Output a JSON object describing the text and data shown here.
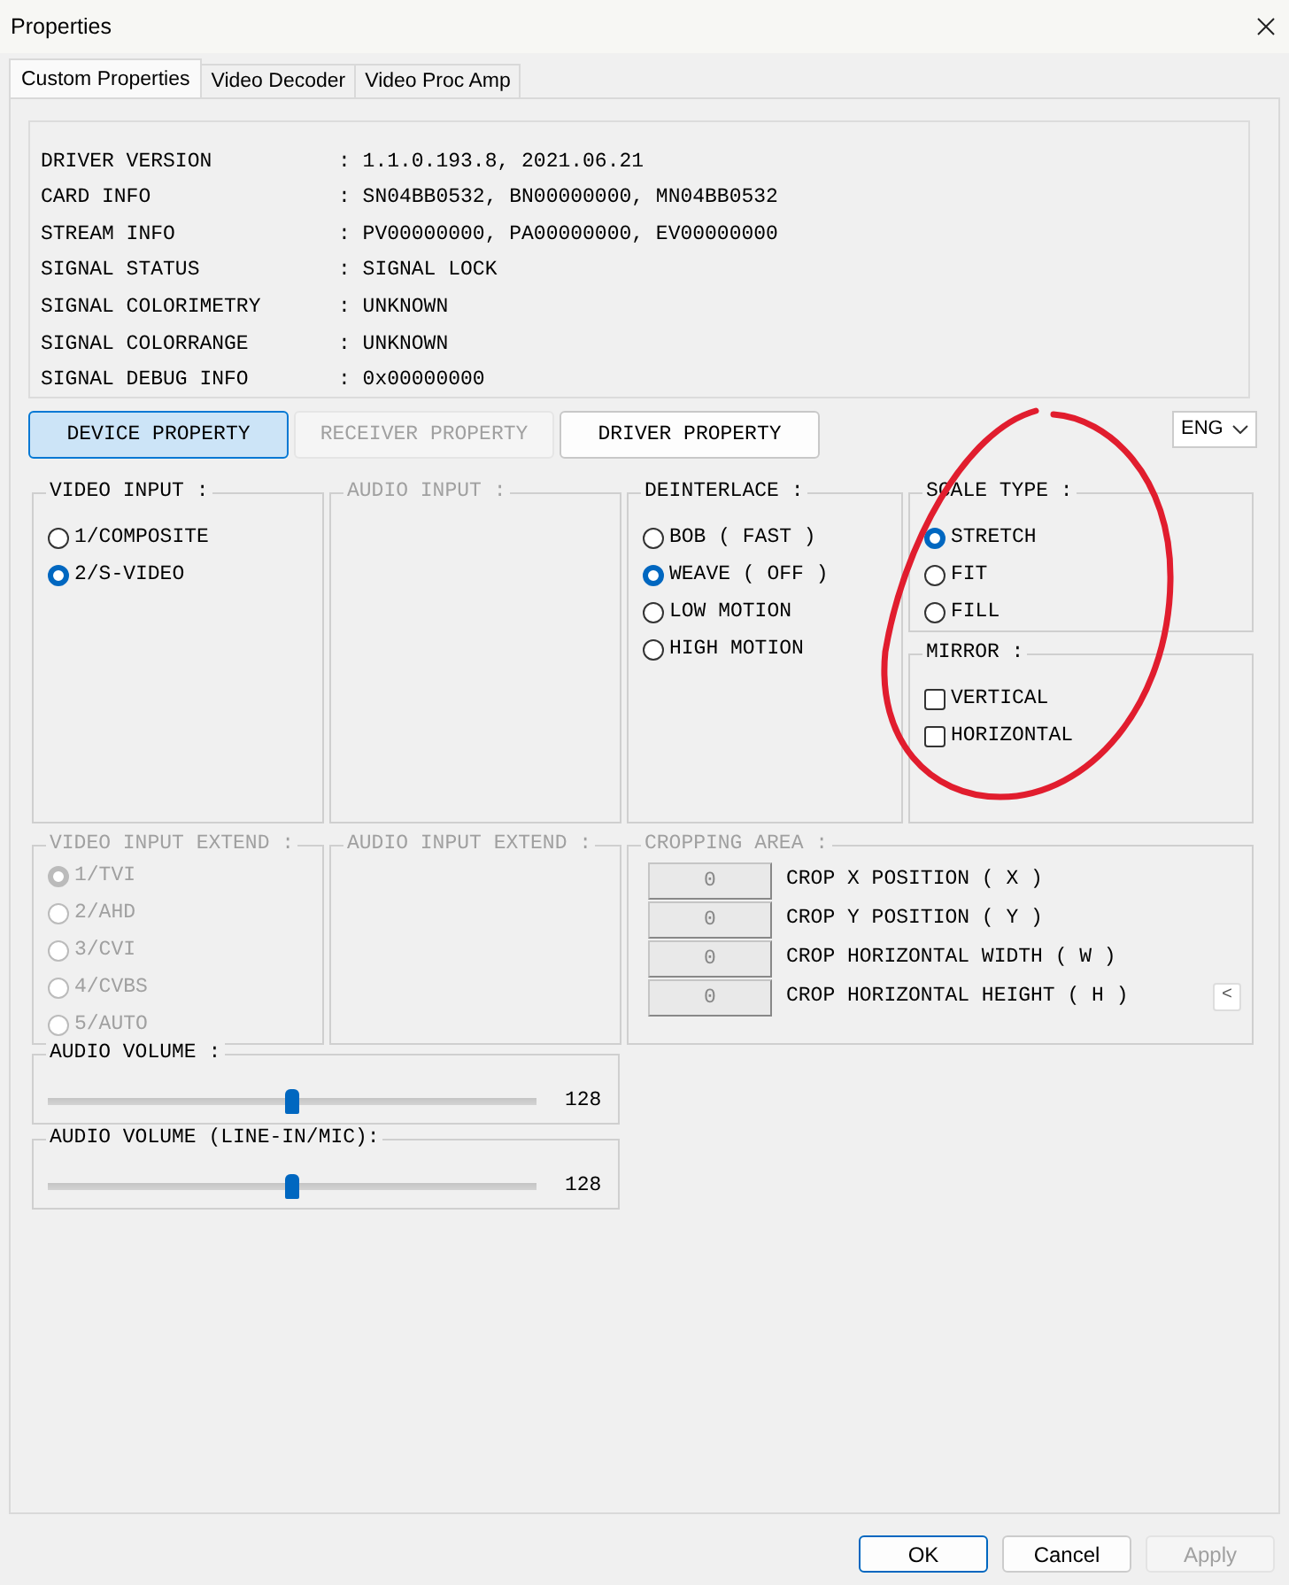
{
  "window": {
    "title": "Properties"
  },
  "tabs": [
    {
      "label": "Custom Properties",
      "selected": true
    },
    {
      "label": "Video Decoder",
      "selected": false
    },
    {
      "label": "Video Proc Amp",
      "selected": false
    }
  ],
  "info_rows": [
    {
      "label": "DRIVER VERSION",
      "value": ": 1.1.0.193.8, 2021.06.21"
    },
    {
      "label": "CARD INFO",
      "value": ": SN04BB0532, BN00000000, MN04BB0532"
    },
    {
      "label": "STREAM INFO",
      "value": ": PV00000000, PA00000000, EV00000000"
    },
    {
      "label": "SIGNAL STATUS",
      "value": ": SIGNAL LOCK"
    },
    {
      "label": "SIGNAL COLORIMETRY",
      "value": ": UNKNOWN"
    },
    {
      "label": "SIGNAL COLORRANGE",
      "value": ": UNKNOWN"
    },
    {
      "label": "SIGNAL DEBUG INFO",
      "value": ": 0x00000000"
    }
  ],
  "property_buttons": [
    {
      "label": "DEVICE PROPERTY",
      "selected": true,
      "disabled": false
    },
    {
      "label": "RECEIVER PROPERTY",
      "selected": false,
      "disabled": true
    },
    {
      "label": "DRIVER PROPERTY",
      "selected": false,
      "disabled": false
    }
  ],
  "language_select": {
    "value": "ENG"
  },
  "video_input": {
    "title": "VIDEO INPUT :",
    "disabled": false,
    "options": [
      {
        "label": "1/COMPOSITE",
        "selected": false
      },
      {
        "label": "2/S-VIDEO",
        "selected": true
      }
    ]
  },
  "audio_input": {
    "title": "AUDIO INPUT :",
    "disabled": true
  },
  "deinterlace": {
    "title": "DEINTERLACE :",
    "disabled": false,
    "options": [
      {
        "label": "BOB ( FAST )",
        "selected": false
      },
      {
        "label": "WEAVE ( OFF )",
        "selected": true
      },
      {
        "label": "LOW MOTION",
        "selected": false
      },
      {
        "label": "HIGH MOTION",
        "selected": false
      }
    ]
  },
  "scale_type": {
    "title": "SCALE TYPE :",
    "disabled": false,
    "options": [
      {
        "label": "STRETCH",
        "selected": true
      },
      {
        "label": "FIT",
        "selected": false
      },
      {
        "label": "FILL",
        "selected": false
      }
    ]
  },
  "mirror": {
    "title": "MIRROR :",
    "disabled": false,
    "options": [
      {
        "label": "VERTICAL",
        "checked": false
      },
      {
        "label": "HORIZONTAL",
        "checked": false
      }
    ]
  },
  "video_input_extend": {
    "title": "VIDEO INPUT EXTEND :",
    "disabled": true,
    "options": [
      {
        "label": "1/TVI",
        "selected": true
      },
      {
        "label": "2/AHD",
        "selected": false
      },
      {
        "label": "3/CVI",
        "selected": false
      },
      {
        "label": "4/CVBS",
        "selected": false
      },
      {
        "label": "5/AUTO",
        "selected": false
      }
    ]
  },
  "audio_input_extend": {
    "title": "AUDIO INPUT EXTEND :",
    "disabled": true
  },
  "cropping_area": {
    "title": "CROPPING AREA :",
    "disabled": true,
    "rows": [
      {
        "value": "0",
        "label": "CROP X POSITION ( X )"
      },
      {
        "value": "0",
        "label": "CROP Y POSITION ( Y )"
      },
      {
        "value": "0",
        "label": "CROP HORIZONTAL WIDTH ( W )"
      },
      {
        "value": "0",
        "label": "CROP HORIZONTAL HEIGHT ( H )"
      }
    ],
    "collapse_button": "<"
  },
  "sliders": [
    {
      "title": "AUDIO VOLUME :",
      "level": 0.5,
      "reading": "128"
    },
    {
      "title": "AUDIO VOLUME (LINE-IN/MIC):",
      "level": 0.5,
      "reading": "128"
    }
  ],
  "footer_buttons": [
    {
      "label": "OK",
      "default": true,
      "disabled": false
    },
    {
      "label": "Cancel",
      "default": false,
      "disabled": false
    },
    {
      "label": "Apply",
      "default": false,
      "disabled": true
    }
  ],
  "annotation": {
    "kind": "circle",
    "color": "#e11d2e"
  }
}
